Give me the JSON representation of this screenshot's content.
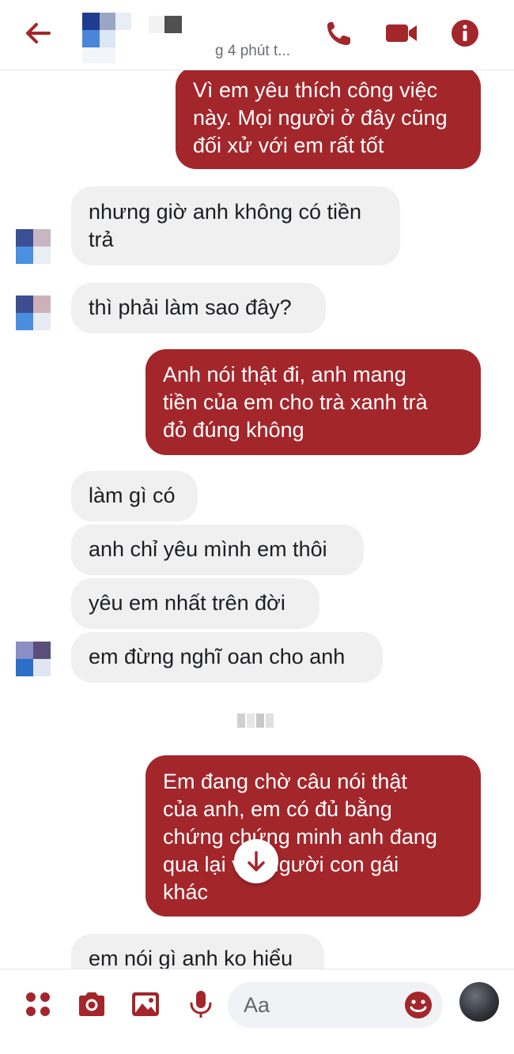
{
  "header": {
    "status": "g 4 phút t..."
  },
  "messages": {
    "m1": {
      "direction": "out",
      "lines": [
        "Vì em yêu thích công việc",
        "này. Mọi người ở đây cũng",
        "đối xử với em rất tốt"
      ]
    },
    "m2": {
      "direction": "in",
      "lines": [
        "nhưng giờ anh không có tiền",
        "trả"
      ]
    },
    "m3": {
      "direction": "in",
      "lines": [
        "thì phải làm sao đây?"
      ]
    },
    "m4": {
      "direction": "out",
      "lines": [
        "Anh nói thật đi, anh mang",
        "tiền của em cho trà xanh trà",
        "đỏ đúng không"
      ]
    },
    "m5": {
      "direction": "in",
      "lines": [
        "làm gì có"
      ]
    },
    "m6": {
      "direction": "in",
      "lines": [
        "anh chỉ yêu mình em thôi"
      ]
    },
    "m7": {
      "direction": "in",
      "lines": [
        "yêu em nhất trên đời"
      ]
    },
    "m8": {
      "direction": "in",
      "lines": [
        "em đừng nghĩ oan cho anh"
      ]
    },
    "m9": {
      "direction": "out",
      "lines": [
        "Em đang chờ câu nói thật",
        "của anh, em có đủ bằng",
        "chứng chứng minh anh đang",
        "qua lại với người con gái",
        "khác"
      ]
    },
    "m10": {
      "direction": "in",
      "lines": [
        "em nói gì anh ko hiểu"
      ]
    }
  },
  "composer": {
    "placeholder": "Aa"
  },
  "icons": {
    "back": "arrow-left-icon",
    "call": "phone-icon",
    "video": "video-camera-icon",
    "info": "info-icon",
    "menu": "four-dots-icon",
    "camera": "camera-icon",
    "gallery": "image-icon",
    "mic": "microphone-icon",
    "emoji": "smiley-icon",
    "scroll": "arrow-down-icon"
  },
  "colors": {
    "accent": "#a3262b",
    "incoming_bubble": "#f0f0f0",
    "outgoing_text": "#ffffff"
  }
}
